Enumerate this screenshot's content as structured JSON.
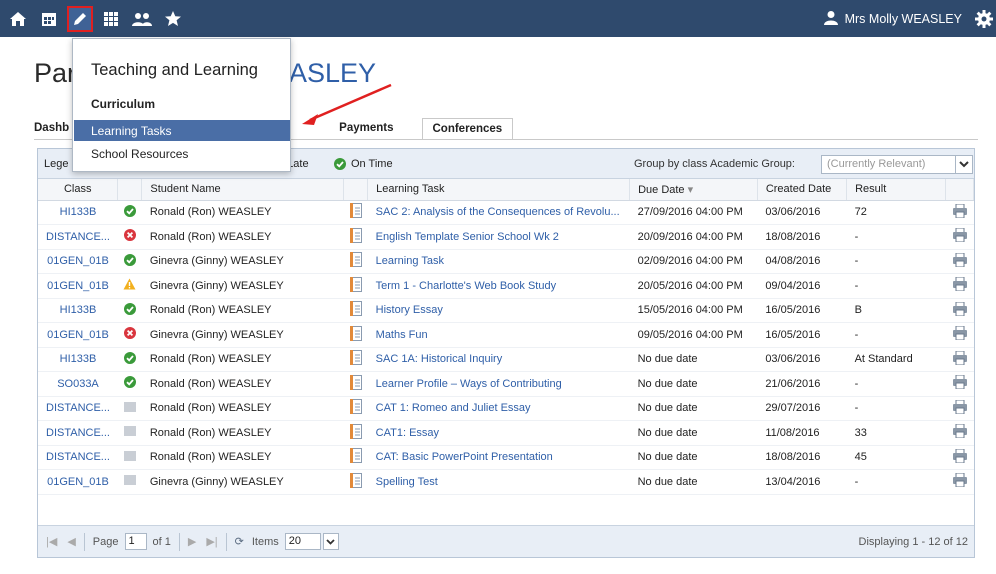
{
  "topbar": {
    "user_name": "Mrs Molly WEASLEY",
    "icons": [
      "home-icon",
      "calendar-icon",
      "pencil-icon",
      "grid-icon",
      "people-icon",
      "star-icon",
      "gear-icon"
    ]
  },
  "page": {
    "title_start": "Par",
    "title_end": "ASLEY"
  },
  "tabs": [
    {
      "label": "Dashb"
    },
    {
      "label": "Payments"
    },
    {
      "label": "Conferences"
    }
  ],
  "legend": {
    "label": "Lege",
    "late_label": "d Late",
    "ontime_label": "On Time",
    "group_by": "Group by class",
    "academic_group_label": "Academic Group:",
    "academic_group_placeholder": "(Currently Relevant)"
  },
  "columns": [
    "Class",
    "",
    "Student Name",
    "",
    "Learning Task",
    "Due Date",
    "Created Date",
    "Result",
    ""
  ],
  "rows": [
    {
      "class": "HI133B",
      "status": "ontime",
      "student": "Ronald (Ron) WEASLEY",
      "task": "SAC 2: Analysis of the Consequences of Revolu...",
      "due": "27/09/2016 04:00 PM",
      "created": "03/06/2016",
      "result": "72"
    },
    {
      "class": "DISTANCE...",
      "status": "late",
      "student": "Ronald (Ron) WEASLEY",
      "task": "English Template Senior School Wk 2",
      "due": "20/09/2016 04:00 PM",
      "created": "18/08/2016",
      "result": "-"
    },
    {
      "class": "01GEN_01B",
      "status": "ontime",
      "student": "Ginevra (Ginny) WEASLEY",
      "task": "Learning Task",
      "due": "02/09/2016 04:00 PM",
      "created": "04/08/2016",
      "result": "-"
    },
    {
      "class": "01GEN_01B",
      "status": "warning",
      "student": "Ginevra (Ginny) WEASLEY",
      "task": "Term 1 - Charlotte's Web Book Study",
      "due": "20/05/2016 04:00 PM",
      "created": "09/04/2016",
      "result": "-"
    },
    {
      "class": "HI133B",
      "status": "ontime",
      "student": "Ronald (Ron) WEASLEY",
      "task": "History Essay",
      "due": "15/05/2016 04:00 PM",
      "created": "16/05/2016",
      "result": "B"
    },
    {
      "class": "01GEN_01B",
      "status": "late",
      "student": "Ginevra (Ginny) WEASLEY",
      "task": "Maths Fun",
      "due": "09/05/2016 04:00 PM",
      "created": "16/05/2016",
      "result": "-"
    },
    {
      "class": "HI133B",
      "status": "ontime",
      "student": "Ronald (Ron) WEASLEY",
      "task": "SAC 1A: Historical Inquiry",
      "due": "No due date",
      "created": "03/06/2016",
      "result": "At Standard"
    },
    {
      "class": "SO033A",
      "status": "ontime",
      "student": "Ronald (Ron) WEASLEY",
      "task": "Learner Profile – Ways of Contributing",
      "due": "No due date",
      "created": "21/06/2016",
      "result": "-"
    },
    {
      "class": "DISTANCE...",
      "status": "none",
      "student": "Ronald (Ron) WEASLEY",
      "task": "CAT 1: Romeo and Juliet Essay",
      "due": "No due date",
      "created": "29/07/2016",
      "result": "-"
    },
    {
      "class": "DISTANCE...",
      "status": "none",
      "student": "Ronald (Ron) WEASLEY",
      "task": "CAT1: Essay",
      "due": "No due date",
      "created": "11/08/2016",
      "result": "33"
    },
    {
      "class": "DISTANCE...",
      "status": "none",
      "student": "Ronald (Ron) WEASLEY",
      "task": "CAT: Basic PowerPoint Presentation",
      "due": "No due date",
      "created": "18/08/2016",
      "result": "45"
    },
    {
      "class": "01GEN_01B",
      "status": "none",
      "student": "Ginevra (Ginny) WEASLEY",
      "task": "Spelling Test",
      "due": "No due date",
      "created": "13/04/2016",
      "result": "-"
    }
  ],
  "pager": {
    "page_label": "Page",
    "page_value": "1",
    "of_label": "of 1",
    "items_label": "Items",
    "items_value": "20",
    "display_text": "Displaying 1 - 12 of 12"
  },
  "menu": {
    "title": "Teaching and Learning",
    "section": "Curriculum",
    "items": [
      "Learning Tasks",
      "School Resources"
    ]
  },
  "colors": {
    "topbar": "#2f4a6d",
    "link": "#2f5fa8",
    "menu_active": "#4a6ea6",
    "ontime": "#3a9a3a",
    "late": "#d9363e",
    "warning": "#f2b01e"
  }
}
